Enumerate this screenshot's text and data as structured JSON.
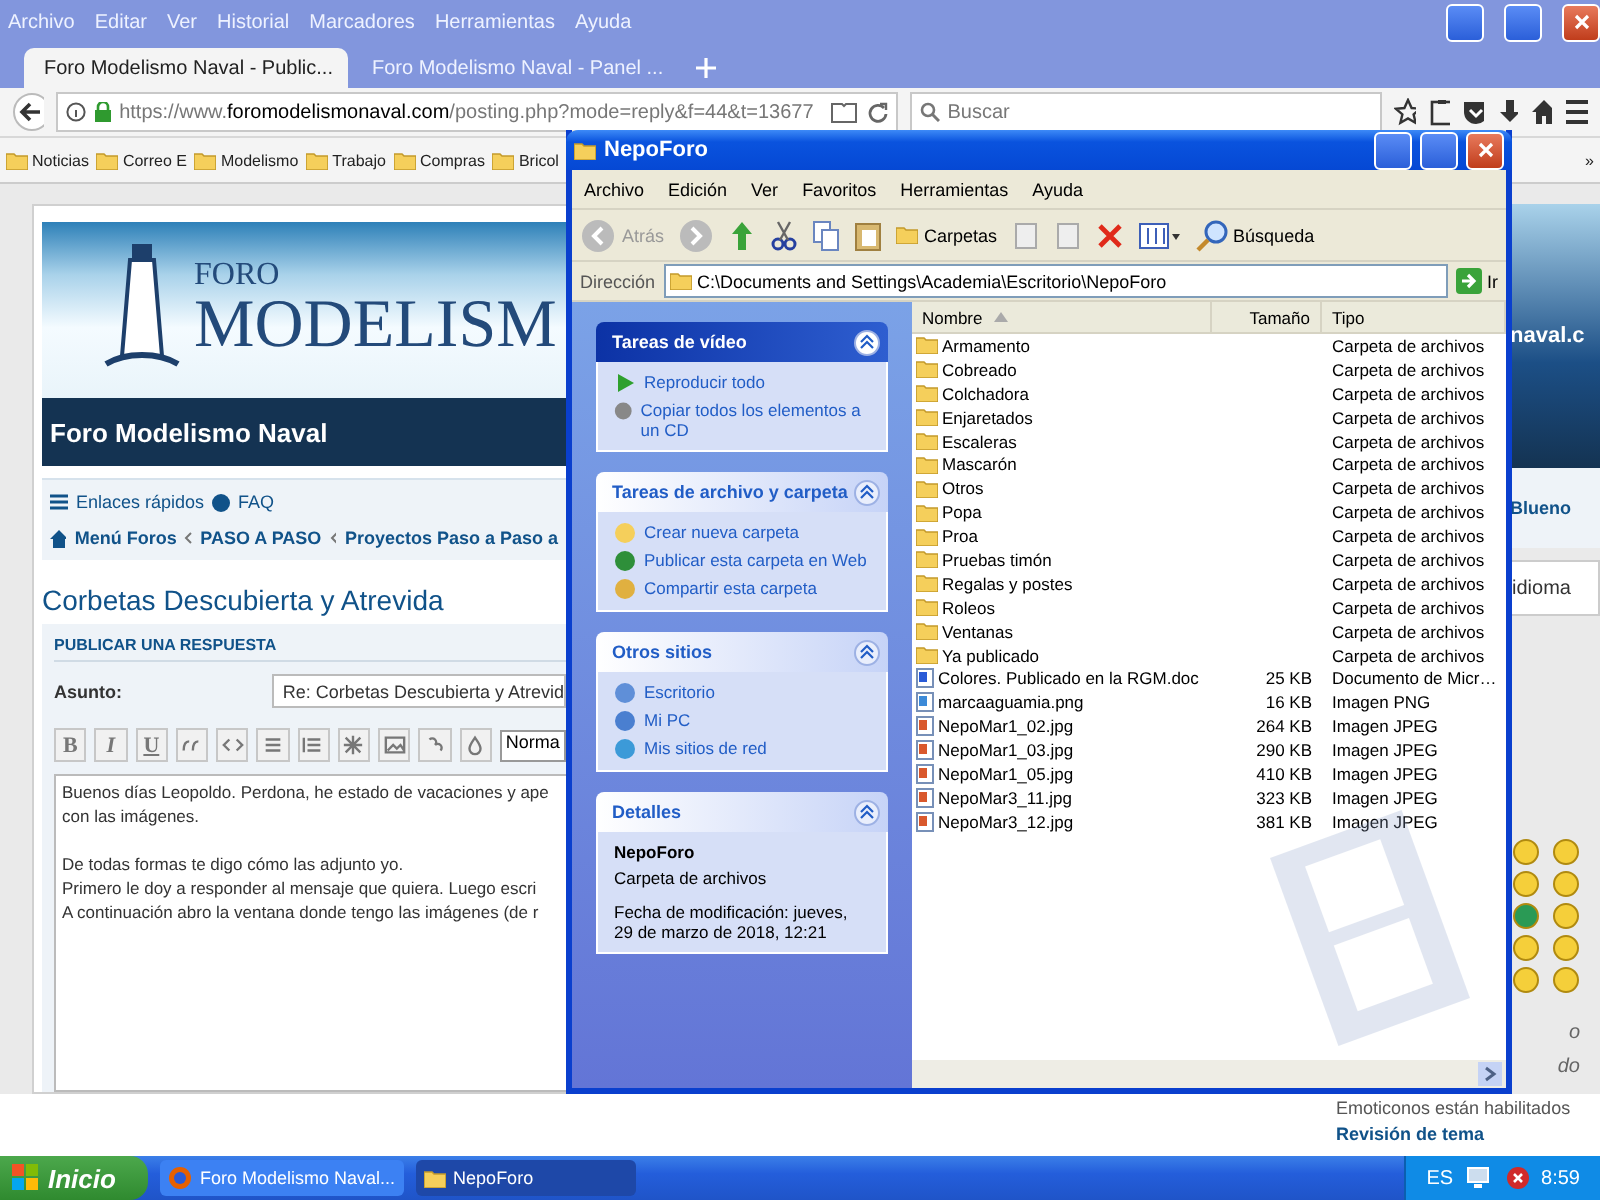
{
  "browser": {
    "menu": [
      "Archivo",
      "Editar",
      "Ver",
      "Historial",
      "Marcadores",
      "Herramientas",
      "Ayuda"
    ],
    "tabs": [
      {
        "title": "Foro Modelismo Naval - Public...",
        "selected": true
      },
      {
        "title": "Foro Modelismo Naval - Panel ...",
        "selected": false
      }
    ],
    "url": {
      "prefix": "https://www.",
      "domain": "foromodelismonaval.com",
      "path": "/posting.php?mode=reply&f=44&t=13677"
    },
    "search": {
      "placeholder": "Buscar"
    },
    "bookmarks": [
      "Noticias",
      "Correo E",
      "Modelismo",
      "Trabajo",
      "Compras",
      "Bricol"
    ],
    "bookmarks_more": "»"
  },
  "forum": {
    "logo_small": "FORO",
    "logo_big": "MODELISM",
    "site_name": "Foro Modelismo Naval",
    "quick_links": "Enlaces rápidos",
    "faq": "FAQ",
    "breadcrumbs": [
      "Menú Foros",
      "PASO A PASO",
      "Proyectos Paso a Paso a"
    ],
    "topic_title": "Corbetas Descubierta y Atrevida",
    "panel_title": "PUBLICAR UNA RESPUESTA",
    "subject_label": "Asunto:",
    "subject_value": "Re: Corbetas Descubierta y Atrevid",
    "toolbar": [
      {
        "kind": "text",
        "label": "B"
      },
      {
        "kind": "text",
        "label": "I"
      },
      {
        "kind": "text",
        "label": "U"
      },
      {
        "kind": "quote"
      },
      {
        "kind": "code"
      },
      {
        "kind": "list"
      },
      {
        "kind": "numlist"
      },
      {
        "kind": "star"
      },
      {
        "kind": "image"
      },
      {
        "kind": "link"
      },
      {
        "kind": "color"
      }
    ],
    "font_size_select": "Norma",
    "message_paragraphs": [
      [
        "Buenos días Leopoldo. Perdona, he estado de vacaciones y ape",
        "con las imágenes."
      ],
      [
        "De todas formas te digo cómo las adjunto yo.",
        "Primero le doy a responder al mensaje que quiera. Luego escri",
        "A continuación abro la ventana donde tengo las imágenes (de r"
      ]
    ],
    "right_fragments": {
      "header": "naval.c",
      "nav_link": "Blueno",
      "field": "idioma",
      "hint_1": "o",
      "hint_2": "do"
    },
    "footer_items": [
      "Emoticonos están habilitados",
      "Revisión de tema"
    ]
  },
  "explorer": {
    "title": "NepoForo",
    "menu": [
      "Archivo",
      "Edición",
      "Ver",
      "Favoritos",
      "Herramientas",
      "Ayuda"
    ],
    "back_label": "Atrás",
    "folders_label": "Carpetas",
    "search_label": "Búsqueda",
    "address_label": "Dirección",
    "address": "C:\\Documents and Settings\\Academia\\Escritorio\\NepoForo",
    "go_label": "Ir",
    "panels": [
      {
        "kind": "special",
        "title": "Tareas de vídeo",
        "expanded": true,
        "items": [
          {
            "kind": "play",
            "label": "Reproducir todo"
          },
          {
            "kind": "cd",
            "label": "Copiar todos los elementos a un CD"
          }
        ]
      },
      {
        "kind": "tasks",
        "title": "Tareas de archivo y carpeta",
        "expanded": true,
        "items": [
          {
            "kind": "folder",
            "label": "Crear nueva carpeta"
          },
          {
            "kind": "globe",
            "label": "Publicar esta carpeta en Web"
          },
          {
            "kind": "share",
            "label": "Compartir esta carpeta"
          }
        ]
      },
      {
        "kind": "tasks",
        "title": "Otros sitios",
        "expanded": true,
        "items": [
          {
            "kind": "desktop",
            "label": "Escritorio"
          },
          {
            "kind": "pc",
            "label": "Mi PC"
          },
          {
            "kind": "network",
            "label": "Mis sitios de red"
          }
        ]
      },
      {
        "kind": "details",
        "title": "Detalles",
        "expanded": true,
        "name": "NepoForo",
        "subtitle": "Carpeta de archivos",
        "info": "Fecha de modificación: jueves, 29 de marzo de 2018, 12:21"
      }
    ],
    "columns": [
      {
        "label": "Nombre",
        "sorted": true
      },
      {
        "label": "Tamaño",
        "sorted": false
      },
      {
        "label": "Tipo",
        "sorted": false
      }
    ],
    "files": [
      {
        "kind": "folder",
        "name": "Armamento",
        "type": "Carpeta de archivos"
      },
      {
        "kind": "folder",
        "name": "Cobreado",
        "type": "Carpeta de archivos"
      },
      {
        "kind": "folder",
        "name": "Colchadora",
        "type": "Carpeta de archivos"
      },
      {
        "kind": "folder",
        "name": "Enjaretados",
        "type": "Carpeta de archivos"
      },
      {
        "kind": "folder",
        "name": "Escaleras",
        "type": "Carpeta de archivos"
      },
      {
        "kind": "folder",
        "name": "Mascarón",
        "type": "Carpeta de archivos"
      },
      {
        "kind": "folder",
        "name": "Otros",
        "type": "Carpeta de archivos"
      },
      {
        "kind": "folder",
        "name": "Popa",
        "type": "Carpeta de archivos"
      },
      {
        "kind": "folder",
        "name": "Proa",
        "type": "Carpeta de archivos"
      },
      {
        "kind": "folder",
        "name": "Pruebas timón",
        "type": "Carpeta de archivos"
      },
      {
        "kind": "folder",
        "name": "Regalas y postes",
        "type": "Carpeta de archivos"
      },
      {
        "kind": "folder",
        "name": "Roleos",
        "type": "Carpeta de archivos"
      },
      {
        "kind": "folder",
        "name": "Ventanas",
        "type": "Carpeta de archivos"
      },
      {
        "kind": "folder",
        "name": "Ya publicado",
        "type": "Carpeta de archivos"
      },
      {
        "kind": "doc",
        "name": "Colores. Publicado en la RGM.doc",
        "size": "25 KB",
        "type": "Documento de Micr…"
      },
      {
        "kind": "png",
        "name": "marcaaguamia.png",
        "size": "16 KB",
        "type": "Imagen PNG"
      },
      {
        "kind": "jpg",
        "name": "NepoMar1_02.jpg",
        "size": "264 KB",
        "type": "Imagen JPEG"
      },
      {
        "kind": "jpg",
        "name": "NepoMar1_03.jpg",
        "size": "290 KB",
        "type": "Imagen JPEG"
      },
      {
        "kind": "jpg",
        "name": "NepoMar1_05.jpg",
        "size": "410 KB",
        "type": "Imagen JPEG"
      },
      {
        "kind": "jpg",
        "name": "NepoMar3_11.jpg",
        "size": "323 KB",
        "type": "Imagen JPEG"
      },
      {
        "kind": "jpg",
        "name": "NepoMar3_12.jpg",
        "size": "381 KB",
        "type": "Imagen JPEG"
      }
    ]
  },
  "taskbar": {
    "start": "Inicio",
    "tasks": [
      {
        "kind": "browser",
        "label": "Foro Modelismo Naval...",
        "selected": false
      },
      {
        "kind": "folder",
        "label": "NepoForo",
        "selected": true
      }
    ],
    "language": "ES",
    "time": "8:59"
  }
}
